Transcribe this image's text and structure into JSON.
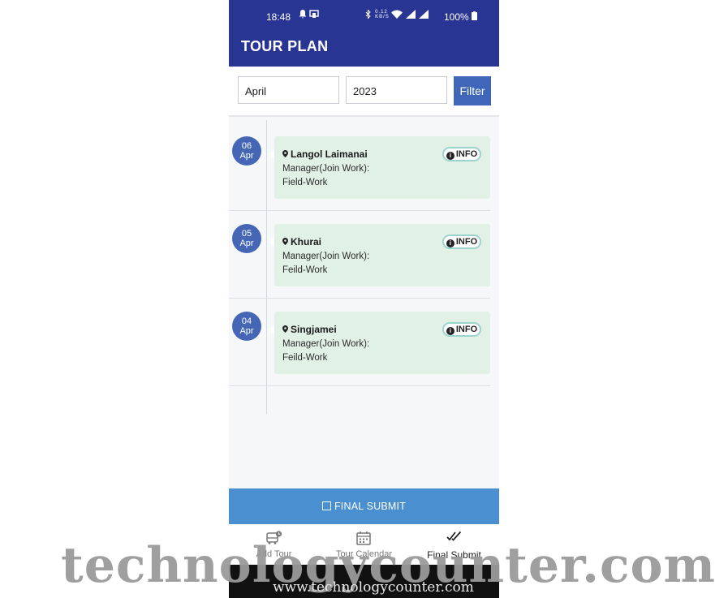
{
  "status_bar": {
    "time": "18:48",
    "network_speed": "0.12 KB/S",
    "battery": "100%"
  },
  "app": {
    "title": "TOUR PLAN"
  },
  "filter": {
    "month_value": "April",
    "year_value": "2023",
    "button_label": "Filter"
  },
  "timeline": [
    {
      "day": "06",
      "month": "Apr",
      "place": "Langol Laimanai",
      "info_label": "INFO",
      "role": "Manager(Join Work):",
      "work": "Field-Work"
    },
    {
      "day": "05",
      "month": "Apr",
      "place": "Khurai",
      "info_label": "INFO",
      "role": "Manager(Join Work):",
      "work": "Feild-Work"
    },
    {
      "day": "04",
      "month": "Apr",
      "place": "Singjamei",
      "info_label": "INFO",
      "role": "Manager(Join Work):",
      "work": "Feild-Work"
    }
  ],
  "submit": {
    "label": "FINAL SUBMIT"
  },
  "bottom_nav": {
    "items": [
      {
        "label": "Add Tour",
        "icon": "bus-clock-icon"
      },
      {
        "label": "Tour Calendar",
        "icon": "calendar-icon"
      },
      {
        "label": "Final Submit",
        "icon": "double-check-icon"
      }
    ]
  },
  "watermark": {
    "text": "technologycounter.com",
    "url": "www.technologycounter.com"
  },
  "colors": {
    "appbar": "#283592",
    "date_badge": "#4466b4",
    "card_bg": "#e2f1e6",
    "submit_bar": "#4a8fd0",
    "filter_button": "#3f66b8"
  }
}
